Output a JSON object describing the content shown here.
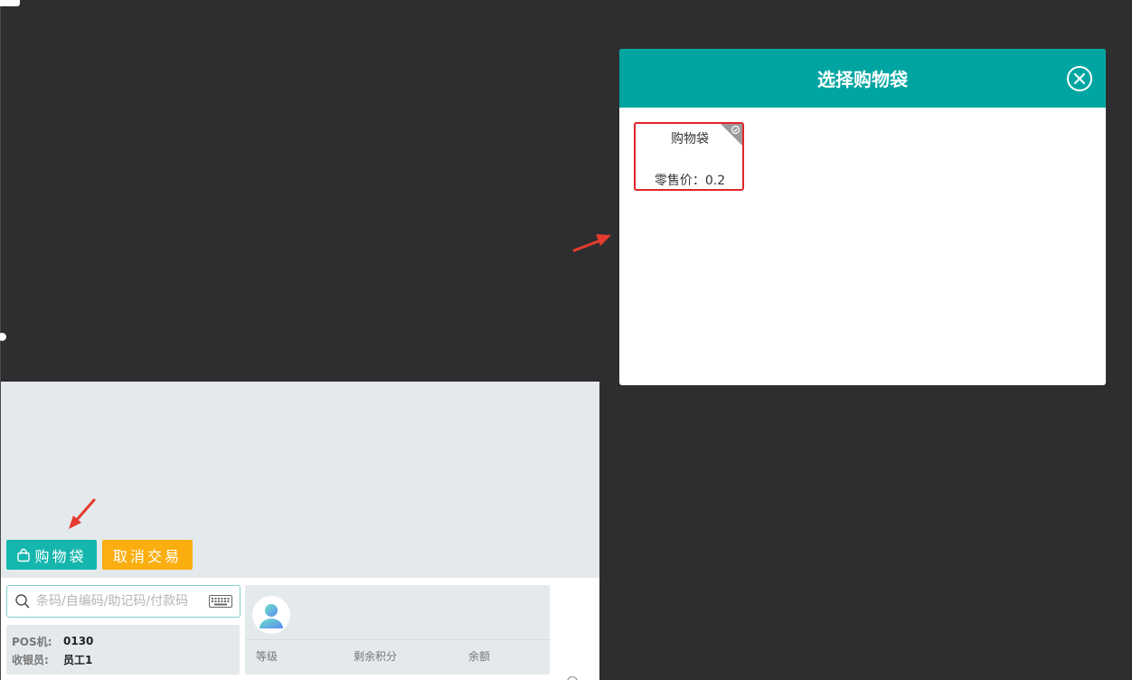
{
  "pos": {
    "bag_button_label": "购物袋",
    "cancel_button_label": "取消交易",
    "search_placeholder": "条码/自编码/助记码/付款码",
    "pos_label": "POS机:",
    "pos_value": "0130",
    "cashier_label": "收银员:",
    "cashier_value": "员工1",
    "member": {
      "level_label": "等级",
      "points_label": "剩余积分",
      "balance_label": "余额"
    }
  },
  "modal": {
    "title": "选择购物袋",
    "items": [
      {
        "name": "购物袋",
        "price_text": "零售价：0.2"
      }
    ]
  },
  "colors": {
    "teal": "#00a5a1",
    "bag_button": "#14b6ad",
    "cancel_button": "#fbae10",
    "highlight": "#e3242b",
    "backdrop": "#2e2e30"
  },
  "icons": {
    "bag": "shopping-bag-icon",
    "search": "search-icon",
    "keyboard": "keyboard-icon",
    "close": "close-circle-icon",
    "avatar": "user-avatar-icon",
    "check": "check-corner-icon",
    "arrow": "red-arrow-icon"
  }
}
